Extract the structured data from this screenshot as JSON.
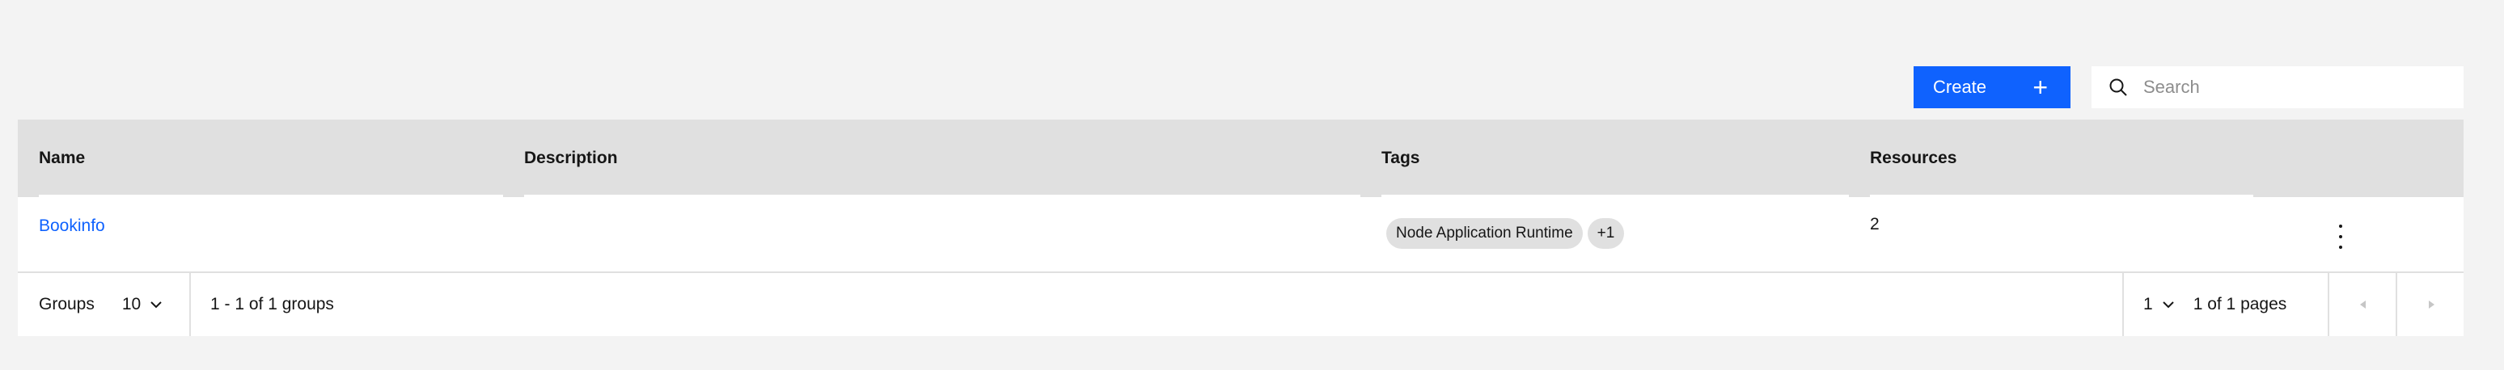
{
  "toolbar": {
    "create_label": "Create",
    "create_icon": "plus-icon",
    "search_placeholder": "Search",
    "search_icon": "search-icon"
  },
  "table": {
    "headers": [
      "Name",
      "Description",
      "Tags",
      "Resources"
    ],
    "rows": [
      {
        "name": "Bookinfo",
        "description": "",
        "tags": [
          "Node Application Runtime",
          "+1"
        ],
        "resources": "2"
      }
    ]
  },
  "pagination": {
    "items_label": "Groups",
    "page_size": "10",
    "range_text": "1 - 1 of 1 groups",
    "current_page": "1",
    "pages_text": "1 of 1 pages"
  },
  "colors": {
    "accent": "#0f62fe",
    "background": "#f3f3f3",
    "header_bg": "#e0e0e0"
  }
}
